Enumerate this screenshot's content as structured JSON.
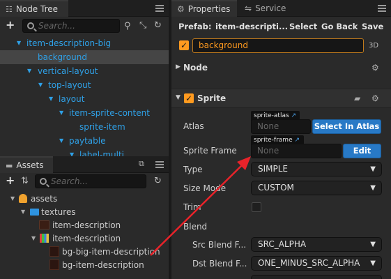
{
  "node_tree": {
    "tab_label": "Node Tree",
    "search_placeholder": "Search...",
    "items": [
      {
        "label": "item-description-big",
        "expanded": true
      },
      {
        "label": "background",
        "selected": true
      },
      {
        "label": "vertical-layout",
        "expanded": true
      },
      {
        "label": "top-layout",
        "expanded": true
      },
      {
        "label": "layout",
        "expanded": true
      },
      {
        "label": "item-sprite-content",
        "expanded": true
      },
      {
        "label": "sprite-item"
      },
      {
        "label": "paytable",
        "expanded": true
      },
      {
        "label": "label-multi"
      }
    ]
  },
  "assets": {
    "tab_label": "Assets",
    "search_placeholder": "Search...",
    "items": [
      {
        "label": "assets",
        "icon": "assets-db-icon"
      },
      {
        "label": "textures",
        "icon": "folder-icon"
      },
      {
        "label": "item-description",
        "icon": "texture-icon"
      },
      {
        "label": "item-description",
        "icon": "spritesheet-icon"
      },
      {
        "label": "bg-big-item-description",
        "icon": "sprite-frame-icon"
      },
      {
        "label": "bg-item-description",
        "icon": "sprite-frame-icon"
      }
    ]
  },
  "properties": {
    "tab_label": "Properties",
    "service_tab_label": "Service",
    "prefab_label": "Prefab:",
    "prefab_name": "item-descripti...",
    "select_label": "Select",
    "go_back_label": "Go Back",
    "save_label": "Save",
    "node_name": "background",
    "node_mode": "3D",
    "node_section": "Node",
    "sprite_section": "Sprite",
    "atlas_label": "Atlas",
    "atlas_tag": "sprite-atlas",
    "atlas_value": "None",
    "select_in_atlas_label": "Select In Atlas",
    "sprite_frame_label": "Sprite Frame",
    "sprite_frame_tag": "sprite-frame",
    "sprite_frame_value": "None",
    "edit_label": "Edit",
    "type_label": "Type",
    "type_value": "SIMPLE",
    "size_mode_label": "Size Mode",
    "size_mode_value": "CUSTOM",
    "trim_label": "Trim",
    "blend_label": "Blend",
    "src_blend_label": "Src Blend F...",
    "src_blend_value": "SRC_ALPHA",
    "dst_blend_label": "Dst Blend F...",
    "dst_blend_value": "ONE_MINUS_SRC_ALPHA"
  },
  "colors": {
    "accent_orange": "#ff9a1f",
    "tree_blue": "#2fa0e6",
    "button_blue": "#2879c6",
    "arrow_red": "#e8232a"
  }
}
